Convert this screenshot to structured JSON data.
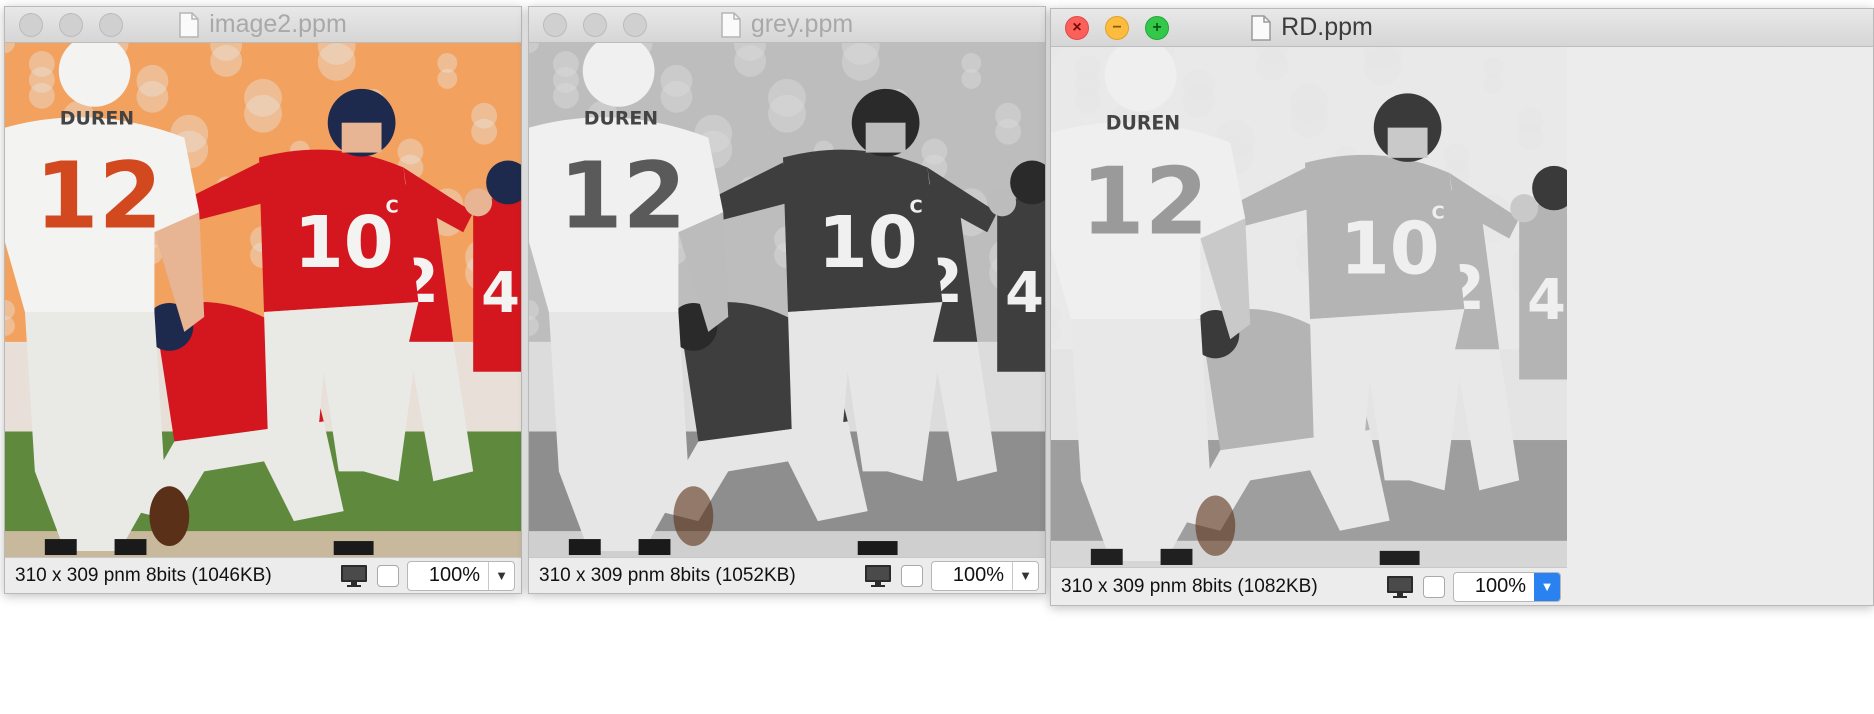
{
  "windows": [
    {
      "title": "image2.ppm",
      "status": "310 x 309  pnm  8bits (1046KB)",
      "zoom": "100%",
      "active": false,
      "mode": "color",
      "icons": [
        "file-icon",
        "monitor-icon",
        "chevron-down-icon"
      ]
    },
    {
      "title": "grey.ppm",
      "status": "310 x 309  pnm  8bits (1052KB)",
      "zoom": "100%",
      "active": false,
      "mode": "grey",
      "icons": [
        "file-icon",
        "monitor-icon",
        "chevron-down-icon"
      ]
    },
    {
      "title": "RD.ppm",
      "status": "310 x 309  pnm  8bits (1082KB)",
      "zoom": "100%",
      "active": true,
      "mode": "redgrey",
      "icons": [
        "file-icon",
        "monitor-icon",
        "chevron-down-icon"
      ]
    }
  ],
  "image_text": {
    "name": "DUREN",
    "num_left": "12",
    "num_qb": "10",
    "num_42": "42",
    "num_4": "4",
    "captain": "C"
  },
  "palettes": {
    "color": {
      "bg_top": "#f2a15e",
      "bg_mid": "#e8e0d8",
      "field": "#5f8a3e",
      "dirt": "#c8b89c",
      "white_jersey": "#f3f3f1",
      "orange_num": "#d2481f",
      "red_jersey": "#d4171f",
      "pants": "#e9e9e6",
      "helmet_dark": "#1d2a4d",
      "skin": "#e7b494",
      "black": "#1a1a1a"
    },
    "grey": {
      "bg_top": "#bdbdbd",
      "bg_mid": "#dcdcdc",
      "field": "#8e8e8e",
      "dirt": "#cfcfcf",
      "white_jersey": "#f0f0f0",
      "orange_num": "#5a5a5a",
      "red_jersey": "#3e3e3e",
      "pants": "#e6e6e6",
      "helmet_dark": "#2a2a2a",
      "skin": "#bcbcbc",
      "black": "#1a1a1a"
    },
    "redgrey": {
      "bg_top": "#e9e9e9",
      "bg_mid": "#e4e4e4",
      "field": "#9e9e9e",
      "dirt": "#d6d6d6",
      "white_jersey": "#efefef",
      "orange_num": "#9a9a9a",
      "red_jersey": "#b4b4b4",
      "pants": "#e8e8e8",
      "helmet_dark": "#3a3a3a",
      "skin": "#c9c9c9",
      "black": "#202020"
    }
  }
}
